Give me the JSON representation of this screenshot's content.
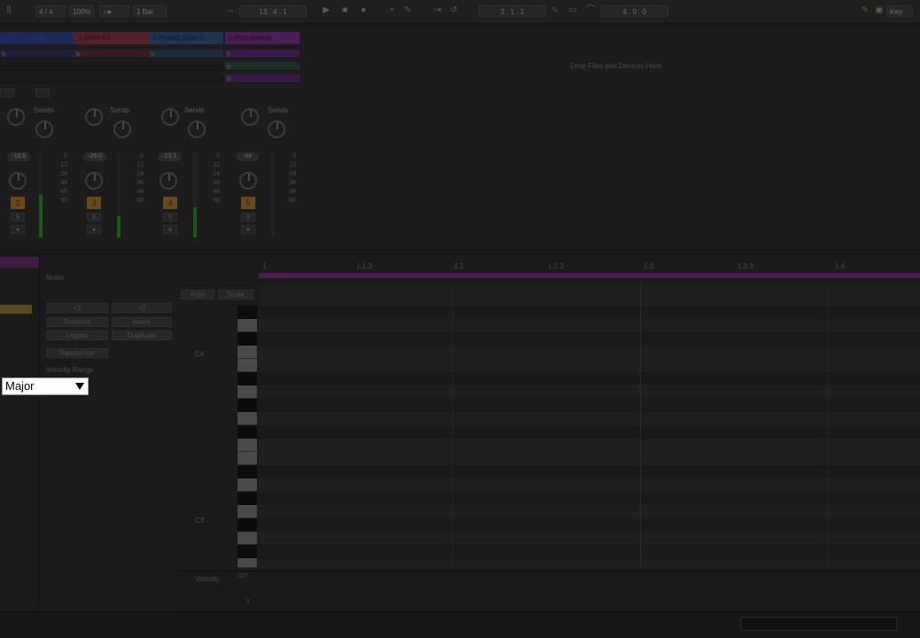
{
  "topbar": {
    "time_signature": "4 / 4",
    "zoom": "100%",
    "metronome": "○●",
    "quantize": "1 Bar",
    "position": "13 . 4 . 1",
    "loop_start": "3 . 1 . 1",
    "loop_length": "4 . 0 . 0",
    "key_label": "Key"
  },
  "session": {
    "drop_text": "Drop Files and Devices Here",
    "tracks": [
      {
        "name": "808 Core Kit",
        "color": "#2a2a66",
        "header_color": "#1e2a5a",
        "number": "2",
        "volume": "-13.5",
        "meter_level": 0.45
      },
      {
        "name": "3 Atom Kit",
        "color": "#5a1f2a",
        "header_color": "#55202c",
        "number": "3",
        "volume": "-29.0",
        "meter_level": 0.25
      },
      {
        "name": "4 Analog Slow 5",
        "color": "#1f3a55",
        "header_color": "#1e3550",
        "number": "4",
        "volume": "-23.1",
        "meter_level": 0.35
      },
      {
        "name": "5 Instruments",
        "color": "#4a1f55",
        "header_color": "#4a1f55",
        "number": "5",
        "volume": "-inf",
        "meter_level": 0
      }
    ],
    "sends_label": "Sends",
    "db_scale": [
      "0",
      "12",
      "24",
      "36",
      "48",
      "60"
    ]
  },
  "notes_panel": {
    "title": "Notes",
    "buttons": {
      "double": "×2",
      "halve": "÷2",
      "reverse": "Reverse",
      "invert": "Invert",
      "legato": "Legato",
      "duplicate": "Duplicate",
      "randomize": "Randomize"
    },
    "velocity_range": "Velocity Range",
    "scale_value": "Major"
  },
  "piano_roll": {
    "fold": "Fold",
    "scale": "Scale",
    "label_c4": "C4",
    "label_c3": "C3",
    "ruler": [
      "1",
      "1.1.3",
      "1.2",
      "1.2.3",
      "1.3",
      "1.3.3",
      "1.4"
    ],
    "velocity_label": "Velocity",
    "velocity_max": "127",
    "velocity_min": "1"
  },
  "colors": {
    "highlight_bg": "#ffffff",
    "highlight_text": "#000000",
    "accent_purple": "#4a1f4f"
  }
}
